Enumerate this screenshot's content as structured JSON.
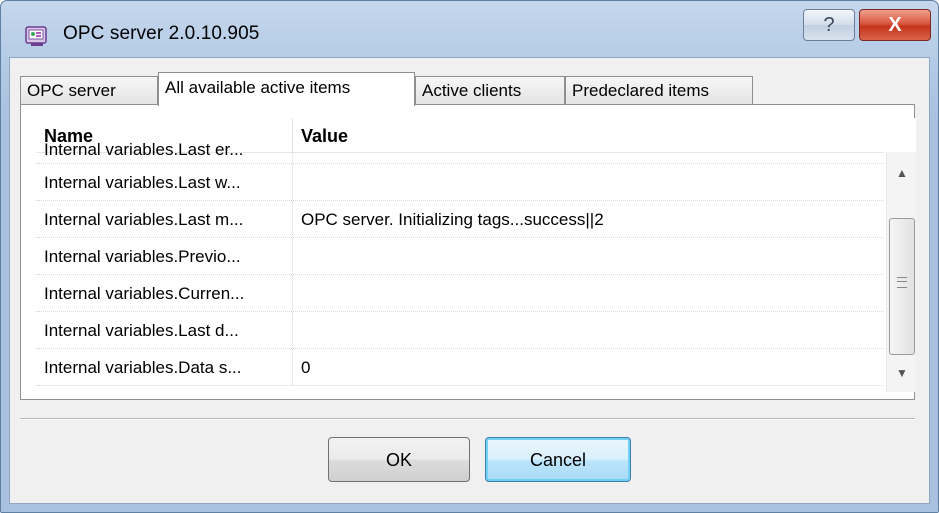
{
  "window": {
    "title": "OPC server 2.0.10.905",
    "help_glyph": "?",
    "close_glyph": "X",
    "icon": "opc-server-app-icon"
  },
  "tabs": [
    {
      "label": "OPC server",
      "active": false
    },
    {
      "label": "All available active items",
      "active": true
    },
    {
      "label": "Active clients",
      "active": false
    },
    {
      "label": "Predeclared items",
      "active": false
    }
  ],
  "list": {
    "columns": [
      "Name",
      "Value"
    ],
    "rows": [
      {
        "name": "Internal variables.Last er...",
        "value": ""
      },
      {
        "name": "Internal variables.Last w...",
        "value": ""
      },
      {
        "name": "Internal variables.Last m...",
        "value": "OPC server. Initializing tags...success||2"
      },
      {
        "name": "Internal variables.Previo...",
        "value": ""
      },
      {
        "name": "Internal variables.Curren...",
        "value": ""
      },
      {
        "name": "Internal variables.Last d...",
        "value": ""
      },
      {
        "name": "Internal variables.Data s...",
        "value": "0"
      }
    ],
    "scrollbar": {
      "up_glyph": "▲",
      "down_glyph": "▼"
    }
  },
  "buttons": {
    "ok": "OK",
    "cancel": "Cancel"
  },
  "colors": {
    "window_frame": "#b4cbe6",
    "close_button": "#c5341b",
    "default_button_border": "#3c7fb1"
  }
}
